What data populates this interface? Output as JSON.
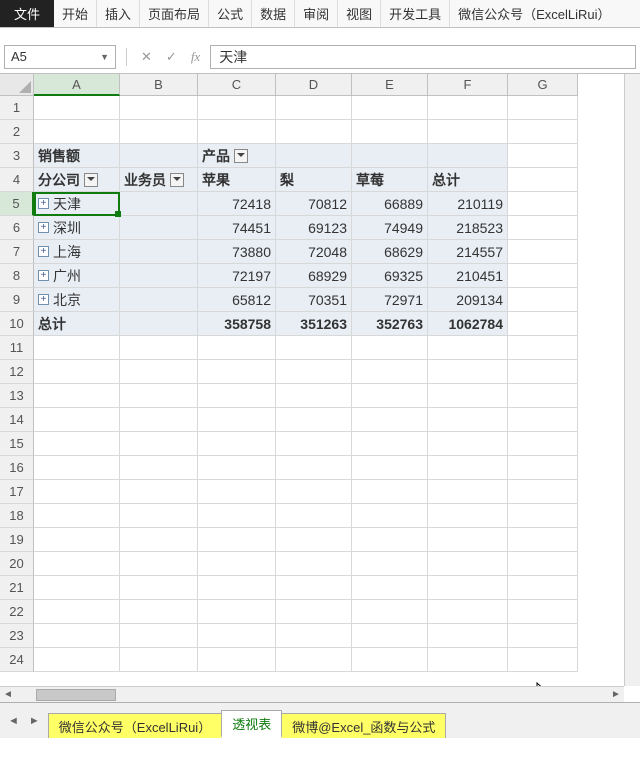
{
  "ribbon": {
    "file": "文件",
    "tabs": [
      "开始",
      "插入",
      "页面布局",
      "公式",
      "数据",
      "审阅",
      "视图",
      "开发工具",
      "微信公众号（ExcelLiRui）"
    ]
  },
  "name_box": "A5",
  "formula_value": "天津",
  "col_headers": [
    "A",
    "B",
    "C",
    "D",
    "E",
    "F",
    "G"
  ],
  "row_headers": [
    "1",
    "2",
    "3",
    "4",
    "5",
    "6",
    "7",
    "8",
    "9",
    "10",
    "11",
    "12",
    "13",
    "14",
    "15",
    "16",
    "17",
    "18",
    "19",
    "20",
    "21",
    "22",
    "23",
    "24"
  ],
  "pivot": {
    "title": "销售额",
    "col_field": "产品",
    "row_field": "分公司",
    "extra_field": "业务员",
    "cols": [
      "苹果",
      "梨",
      "草莓",
      "总计"
    ],
    "rows": [
      {
        "name": "天津",
        "vals": [
          72418,
          70812,
          66889,
          210119
        ]
      },
      {
        "name": "深圳",
        "vals": [
          74451,
          69123,
          74949,
          218523
        ]
      },
      {
        "name": "上海",
        "vals": [
          73880,
          72048,
          68629,
          214557
        ]
      },
      {
        "name": "广州",
        "vals": [
          72197,
          68929,
          69325,
          210451
        ]
      },
      {
        "name": "北京",
        "vals": [
          65812,
          70351,
          72971,
          209134
        ]
      }
    ],
    "grand_label": "总计",
    "grand": [
      358758,
      351263,
      352763,
      1062784
    ]
  },
  "sheet_tabs": [
    "微信公众号（ExcelLiRui）",
    "透视表",
    "微博@Excel_函数与公式"
  ],
  "active_sheet_index": 1,
  "chart_data": {
    "type": "table",
    "title": "销售额",
    "row_field": "分公司",
    "col_field": "产品",
    "columns": [
      "苹果",
      "梨",
      "草莓",
      "总计"
    ],
    "rows": [
      "天津",
      "深圳",
      "上海",
      "广州",
      "北京",
      "总计"
    ],
    "values": [
      [
        72418,
        70812,
        66889,
        210119
      ],
      [
        74451,
        69123,
        74949,
        218523
      ],
      [
        73880,
        72048,
        68629,
        214557
      ],
      [
        72197,
        68929,
        69325,
        210451
      ],
      [
        65812,
        70351,
        72971,
        209134
      ],
      [
        358758,
        351263,
        352763,
        1062784
      ]
    ]
  }
}
